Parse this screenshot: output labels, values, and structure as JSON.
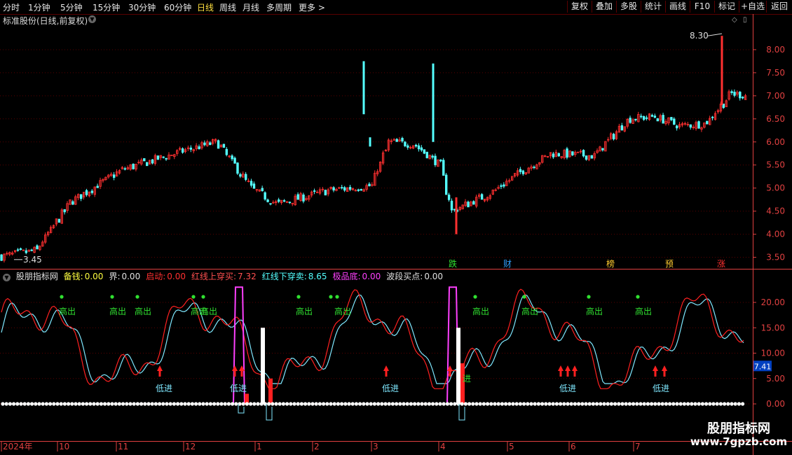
{
  "toolbar": {
    "periods": [
      "分时",
      "1分钟",
      "5分钟",
      "15分钟",
      "30分钟",
      "60分钟",
      "日线",
      "周线",
      "月线",
      "多周期",
      "更多 >"
    ],
    "active_period": "日线",
    "buttons": [
      "复权",
      "叠加",
      "多股",
      "统计",
      "画线",
      "F10",
      "标记",
      "+自选",
      "返回"
    ]
  },
  "main_chart": {
    "title": "标准股份(日线,前复权)",
    "high_label": "8.30",
    "low_label": "3.45",
    "y_ticks": [
      "8.00",
      "7.50",
      "7.00",
      "6.50",
      "6.00",
      "5.50",
      "5.00",
      "4.50",
      "4.00",
      "3.50"
    ],
    "y_range": [
      3.25,
      8.5
    ],
    "colors": {
      "up": "#ff3030",
      "down": "#54ffff",
      "grid": "#5a0000",
      "axis": "#e04040"
    }
  },
  "markers": [
    {
      "text": "跌",
      "color": "#30e030"
    },
    {
      "text": "财",
      "color": "#30a0ff"
    },
    {
      "text": "榜",
      "color": "#ffcc30"
    },
    {
      "text": "预",
      "color": "#ffcc30"
    },
    {
      "text": "涨",
      "color": "#ff3030"
    }
  ],
  "indicator": {
    "name": "股朋指标网",
    "values": [
      {
        "label": "备钱:",
        "value": "0.00",
        "color": "#ffff40"
      },
      {
        "label": "界:",
        "value": "0.00",
        "color": "#e0e0e0"
      },
      {
        "label": "启动:",
        "value": "0.00",
        "color": "#ff3030"
      },
      {
        "label": "红线上穿买:",
        "value": "7.32",
        "color": "#ff5050"
      },
      {
        "label": "红线下穿卖:",
        "value": "8.65",
        "color": "#54ffff"
      },
      {
        "label": "极品底:",
        "value": "0.00",
        "color": "#ff40ff"
      },
      {
        "label": "波段买点:",
        "value": "0.00",
        "color": "#e0e0e0"
      }
    ],
    "y_ticks": [
      "20.00",
      "15.00",
      "10.00",
      "5.00",
      "0.00"
    ],
    "current_value": "7.41",
    "sell_label": "高出",
    "buy_label": "低进",
    "extra_label": "进"
  },
  "x_axis": {
    "labels": [
      "2024年",
      "10",
      "11",
      "12",
      "1",
      "2",
      "3",
      "4",
      "5",
      "6",
      "7"
    ]
  },
  "watermark": {
    "line1": "股朋指标网",
    "line2": "www.7gpzb.com"
  }
}
